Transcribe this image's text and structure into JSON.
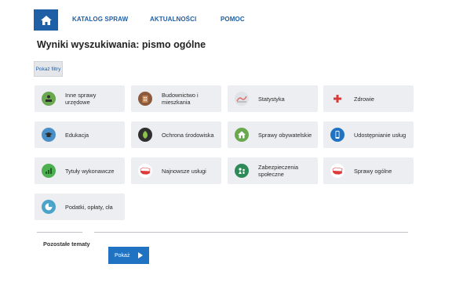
{
  "nav": {
    "home_icon": "home-icon",
    "links": [
      "KATALOG SPRAW",
      "AKTUALNOŚCI",
      "POMOC"
    ]
  },
  "page_title": "Wyniki wyszukiwania: pismo ogólne",
  "filter_button": "Pokaż filtry",
  "tiles": [
    {
      "label": "Inne sprawy urzędowe",
      "icon": "official-matters-icon",
      "color": "#6aa84f"
    },
    {
      "label": "Budownictwo i mieszkania",
      "icon": "building-icon",
      "color": "#8b5a3c"
    },
    {
      "label": "Statystyka",
      "icon": "statistics-icon",
      "color": "#dfe2e6"
    },
    {
      "label": "Zdrowie",
      "icon": "health-cross-icon",
      "color": "#d93a3a"
    },
    {
      "label": "Edukacja",
      "icon": "education-cap-icon",
      "color": "#4a90c8"
    },
    {
      "label": "Ochrona środowiska",
      "icon": "environment-leaf-icon",
      "color": "#2f2f2f"
    },
    {
      "label": "Sprawy obywatelskie",
      "icon": "citizen-house-icon",
      "color": "#6aa84f"
    },
    {
      "label": "Udostępnianie usług",
      "icon": "mobile-device-icon",
      "color": "#1f73c2"
    },
    {
      "label": "Tytuły wykonawcze",
      "icon": "enforcement-chart-icon",
      "color": "#4caf50"
    },
    {
      "label": "Najnowsze usługi",
      "icon": "poland-map-icon",
      "color": "#ffffff"
    },
    {
      "label": "Zabezpieczenia społeczne",
      "icon": "social-security-icon",
      "color": "#2e8b57"
    },
    {
      "label": "Sprawy ogólne",
      "icon": "poland-map-icon",
      "color": "#ffffff"
    },
    {
      "label": "Podatki, opłaty, cła",
      "icon": "taxes-pie-icon",
      "color": "#4aa3c8"
    }
  ],
  "other_topics_label": "Pozostałe tematy",
  "show_button": "Pokaż"
}
